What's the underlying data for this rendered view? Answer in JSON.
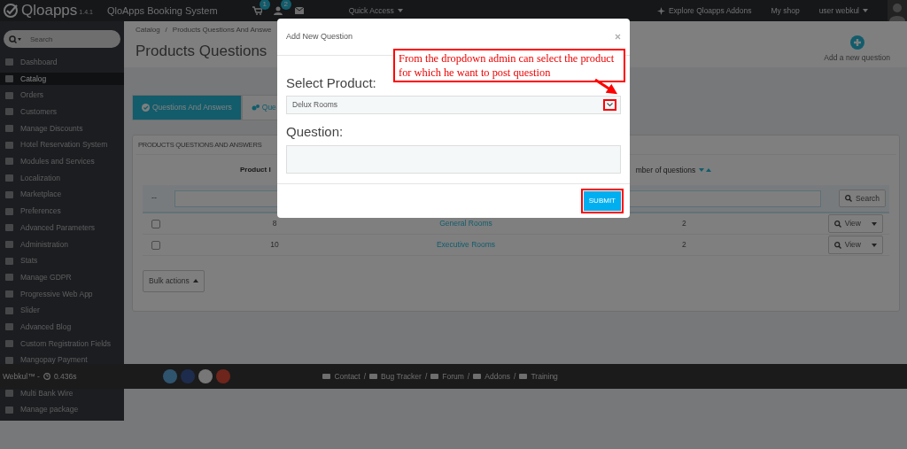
{
  "topbar": {
    "logo_name": "Qloapps",
    "version": "1.4.1",
    "shop_title": "QloApps Booking System",
    "notifications": [
      {
        "kind": "cart",
        "count": "1"
      },
      {
        "kind": "person",
        "count": "2"
      },
      {
        "kind": "mail"
      }
    ],
    "quick_access": "Quick Access",
    "links": [
      "Explore Qloapps Addons",
      "My shop"
    ],
    "user": "user webkul"
  },
  "sidebar": {
    "search_placeholder": "Search",
    "items": [
      {
        "label": "Dashboard",
        "selected": false
      },
      {
        "label": "Catalog",
        "selected": true
      },
      {
        "label": "Orders",
        "selected": false
      },
      {
        "label": "Customers",
        "selected": false
      },
      {
        "label": "Manage Discounts",
        "selected": false
      },
      {
        "label": "Hotel Reservation System",
        "selected": false
      },
      {
        "label": "Modules and Services",
        "selected": false
      },
      {
        "label": "Localization",
        "selected": false
      },
      {
        "label": "Marketplace",
        "selected": false
      },
      {
        "label": "Preferences",
        "selected": false
      },
      {
        "label": "Advanced Parameters",
        "selected": false
      },
      {
        "label": "Administration",
        "selected": false
      },
      {
        "label": "Stats",
        "selected": false
      },
      {
        "label": "Manage GDPR",
        "selected": false
      },
      {
        "label": "Progressive Web App",
        "selected": false
      },
      {
        "label": "Slider",
        "selected": false
      },
      {
        "label": "Advanced Blog",
        "selected": false
      },
      {
        "label": "Custom Registration Fields",
        "selected": false
      },
      {
        "label": "Mangopay Payment",
        "selected": false
      },
      {
        "label": "Multi Bank Wire",
        "selected": false
      },
      {
        "label": "Manage package",
        "selected": false
      }
    ]
  },
  "header": {
    "breadcrumb": [
      "Catalog",
      "Products Questions And Answe"
    ],
    "breadcrumb_separator": "/",
    "title": "Products Questions",
    "add_button": "Add a new question"
  },
  "tabs": [
    {
      "label": "Questions And Answers",
      "selected": true
    },
    {
      "label": "Que",
      "selected": false
    }
  ],
  "panel": {
    "title": "PRODUCTS QUESTIONS AND ANSWERS",
    "columns": [
      "Product I",
      "mber of questions"
    ],
    "column_1_filter": "--",
    "search_button": "Search",
    "rows": [
      {
        "checked": false,
        "id": "8",
        "name": "General Rooms",
        "count": "2",
        "action": "View"
      },
      {
        "checked": false,
        "id": "10",
        "name": "Executive Rooms",
        "count": "2",
        "action": "View"
      }
    ],
    "bulk_actions": "Bulk actions"
  },
  "footer": {
    "credit": "Webkul™ -",
    "time": "0.436s",
    "social": [
      {
        "kind": "twitter"
      },
      {
        "kind": "facebook"
      },
      {
        "kind": "github"
      },
      {
        "kind": "googleplus"
      }
    ],
    "separator": "/",
    "links": [
      "Contact",
      "Bug Tracker",
      "Forum",
      "Addons",
      "Training"
    ]
  },
  "modal": {
    "title": "Add New Question",
    "product_label": "Select Product:",
    "product_value": "Delux Rooms",
    "question_label": "Question:",
    "submit": "SUBMIT"
  },
  "annotation": {
    "text": "From the dropdown admin can select the product for which he want to post question"
  }
}
